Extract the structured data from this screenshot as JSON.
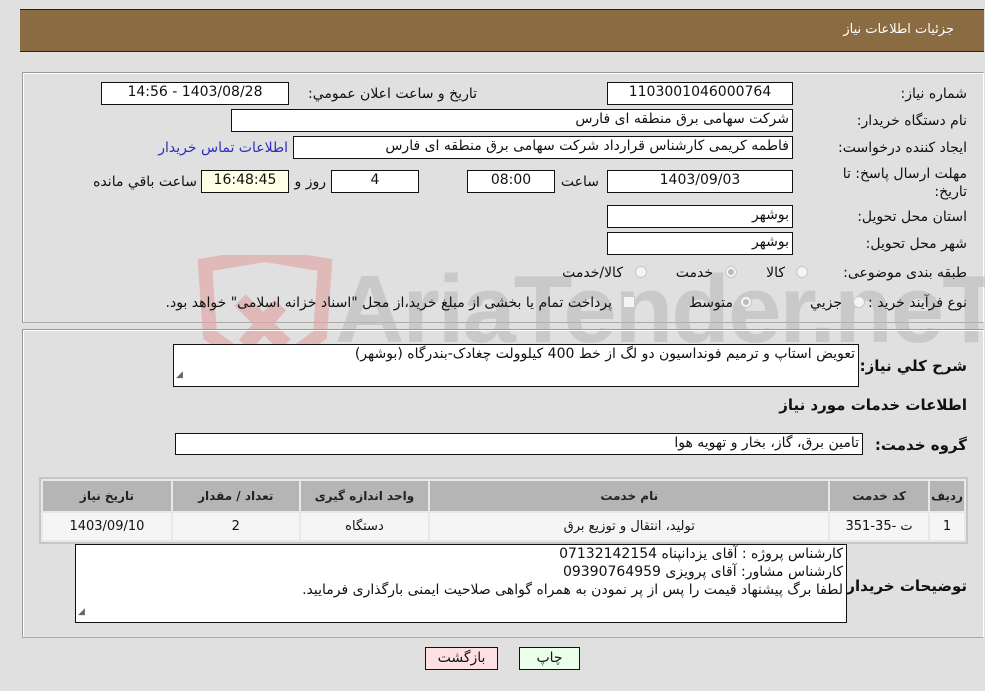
{
  "header": {
    "title": "جزئیات اطلاعات نیاز"
  },
  "fields": {
    "need_number": {
      "label": "شماره نیاز:",
      "value": "1103001046000764"
    },
    "announce_datetime": {
      "label": "تاریخ و ساعت اعلان عمومي:",
      "value": "1403/08/28 - 14:56"
    },
    "buyer_org": {
      "label": "نام دستگاه خریدار:",
      "value": "شرکت سهامی برق منطقه ای فارس"
    },
    "requester": {
      "label": "ایجاد کننده درخواست:",
      "value": "فاطمه کریمی کارشناس قرارداد شرکت سهامی برق منطقه ای فارس",
      "contact_link": "اطلاعات تماس خریدار"
    },
    "deadline": {
      "label": "مهلت ارسال پاسخ: تا تاریخ:",
      "date": "1403/09/03",
      "time_label": "ساعت",
      "time": "08:00",
      "days": "4",
      "days_label": "روز و",
      "remaining": "16:48:45",
      "remaining_label": "ساعت باقي مانده"
    },
    "province": {
      "label": "استان محل تحویل:",
      "value": "بوشهر"
    },
    "city": {
      "label": "شهر محل تحویل:",
      "value": "بوشهر"
    },
    "category": {
      "label": "طبقه بندی موضوعی:",
      "options": [
        "کالا",
        "خدمت",
        "کالا/خدمت"
      ],
      "selected": "خدمت"
    },
    "purchase_type": {
      "label": "نوع فرآیند خرید :",
      "options": [
        "جزيي",
        "متوسط"
      ],
      "selected": "متوسط",
      "treasury_checkbox_label": "پرداخت تمام یا بخشی از مبلغ خرید،از محل \"اسناد خزانه اسلامی\" خواهد بود.",
      "treasury_checked": false
    }
  },
  "description": {
    "label": "شرح کلي نیاز:",
    "value": "تعویض استاپ و ترمیم فونداسیون دو لگ از خط 400 کیلوولت چغادک-بندرگاه (بوشهر)"
  },
  "services_section": {
    "title": "اطلاعات خدمات مورد نیاز"
  },
  "service_group": {
    "label": "گروه خدمت:",
    "value": "تامین برق، گاز، بخار و تهویه هوا"
  },
  "table": {
    "headers": [
      "ردیف",
      "کد خدمت",
      "نام خدمت",
      "واحد اندازه گیری",
      "تعداد / مقدار",
      "تاریخ نیاز"
    ],
    "rows": [
      [
        "1",
        "ت -35-351",
        "تولید، انتقال و توزیع برق",
        "دستگاه",
        "2",
        "1403/09/10"
      ]
    ]
  },
  "buyer_notes": {
    "label": "توضیحات خریدار:",
    "lines": [
      "کارشناس پروژه : آقای یزدانپناه 07132142154",
      "کارشناس مشاور: آقای پرویزی 09390764959",
      "لطفا برگ پیشنهاد قیمت را پس از پر نمودن به همراه گواهی صلاحیت ایمنی بارگذاری فرمایید."
    ]
  },
  "buttons": {
    "print": "چاپ",
    "back": "بازگشت"
  },
  "watermark": {
    "text": "AriaTender.neT"
  },
  "colors": {
    "header_bg": "#8b6c42",
    "print_bg": "#eaffea",
    "back_bg": "#ffe0e0",
    "link": "#2c2cbf",
    "remaining_bg": "#ffffe6"
  }
}
